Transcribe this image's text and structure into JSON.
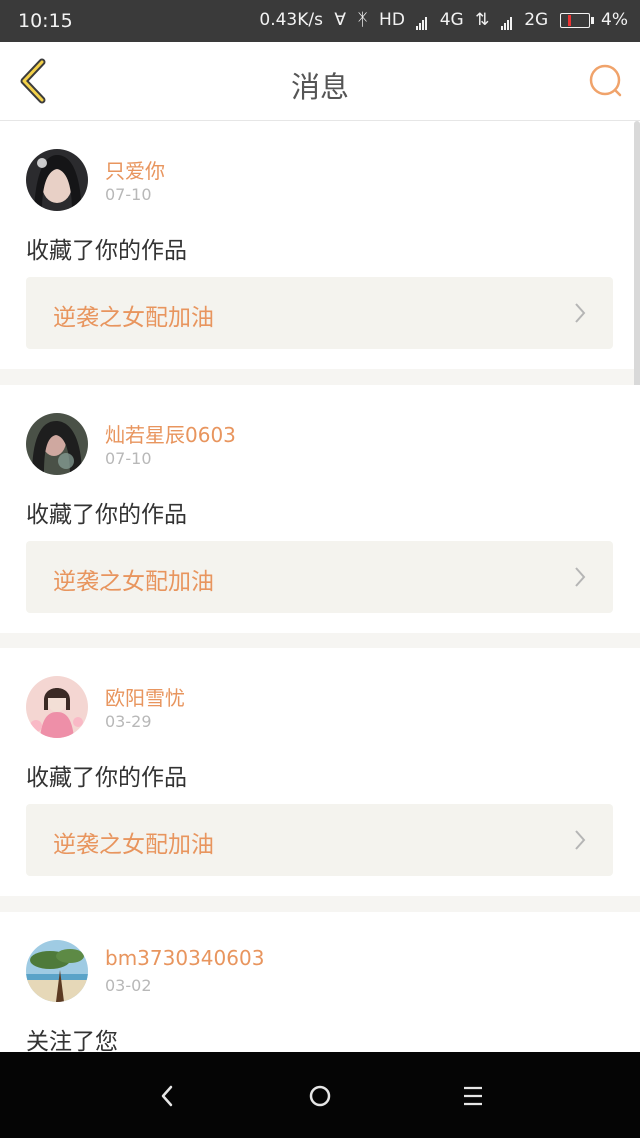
{
  "status_bar": {
    "time": "10:15",
    "net_speed": "0.43K/s",
    "hd": "HD",
    "net1": "4G",
    "net2": "2G",
    "battery": "4%"
  },
  "header": {
    "title": "消息",
    "back_icon": "back-chevron-icon",
    "search_icon": "search-icon",
    "accent_color": "#e8955e"
  },
  "messages": [
    {
      "user": "只爱你",
      "date": "07-10",
      "action": "收藏了你的作品",
      "work": "逆袭之女配加油",
      "avatar": "avatar-photo-1"
    },
    {
      "user": "灿若星辰0603",
      "date": "07-10",
      "action": "收藏了你的作品",
      "work": "逆袭之女配加油",
      "avatar": "avatar-photo-2"
    },
    {
      "user": "欧阳雪忧",
      "date": "03-29",
      "action": "收藏了你的作品",
      "work": "逆袭之女配加油",
      "avatar": "avatar-photo-3"
    },
    {
      "user": "bm3730340603",
      "date": "03-02",
      "action": "关注了您",
      "work": "",
      "avatar": "avatar-photo-4"
    }
  ],
  "system_nav": {
    "back": "back-triangle-icon",
    "home": "home-circle-icon",
    "menu": "menu-icon"
  }
}
